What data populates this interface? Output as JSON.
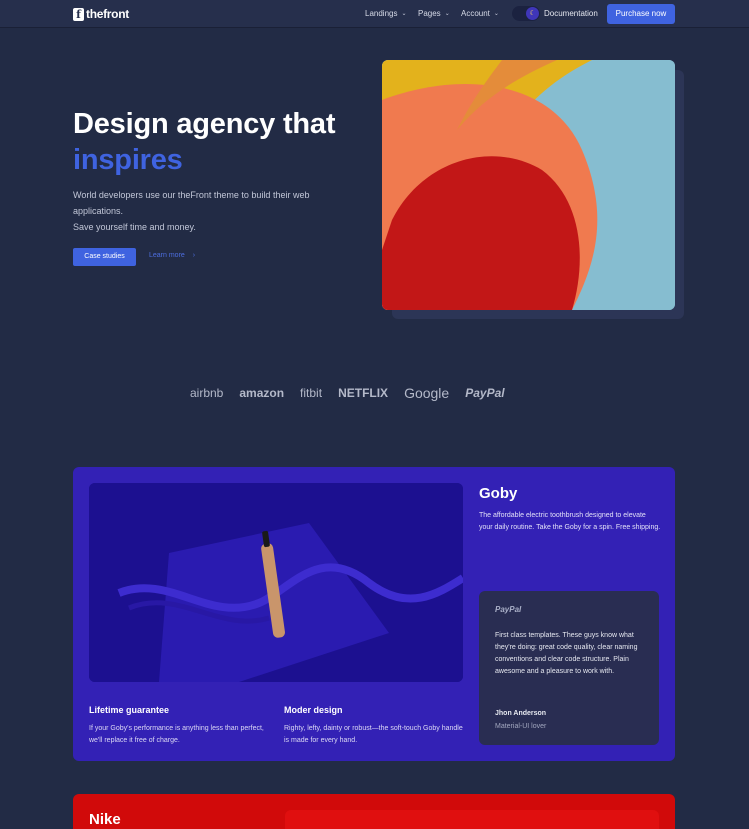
{
  "header": {
    "logo_text": "thefront",
    "logo_mark": "f",
    "nav": [
      {
        "label": "Landings"
      },
      {
        "label": "Pages"
      },
      {
        "label": "Account"
      }
    ],
    "theme_toggle_icon": "moon-icon",
    "documentation": "Documentation",
    "purchase": "Purchase now"
  },
  "hero": {
    "title_line1": "Design agency that",
    "title_line2": "inspires",
    "description_line1": "World developers use our theFront theme to build their web applications.",
    "description_line2": "Save yourself time and money.",
    "primary_button": "Case studies",
    "secondary_link": "Learn more",
    "accent_color": "#3f63e0"
  },
  "partners": [
    "airbnb",
    "amazon",
    "fitbit",
    "NETFLIX",
    "Google",
    "PayPal"
  ],
  "goby": {
    "title": "Goby",
    "description": "The affordable electric toothbrush designed to elevate your daily routine. Take the Goby for a spin. Free shipping.",
    "features": [
      {
        "title": "Lifetime guarantee",
        "text": "If your Goby's performance is anything less than perfect, we'll replace it free of charge."
      },
      {
        "title": "Moder design",
        "text": "Righty, lefty, dainty or robust—the soft-touch Goby handle is made for every hand."
      }
    ],
    "testimonial": {
      "logo": "PayPal",
      "quote": "First class templates. These guys know what they're doing: great code quality, clear naming conventions and clear code structure. Plain awesome and a pleasure to work with.",
      "name": "Jhon Anderson",
      "role": "Material-UI lover"
    },
    "card_color": "#3321b5"
  },
  "nike": {
    "title": "Nike",
    "card_color": "#d10a0a"
  }
}
